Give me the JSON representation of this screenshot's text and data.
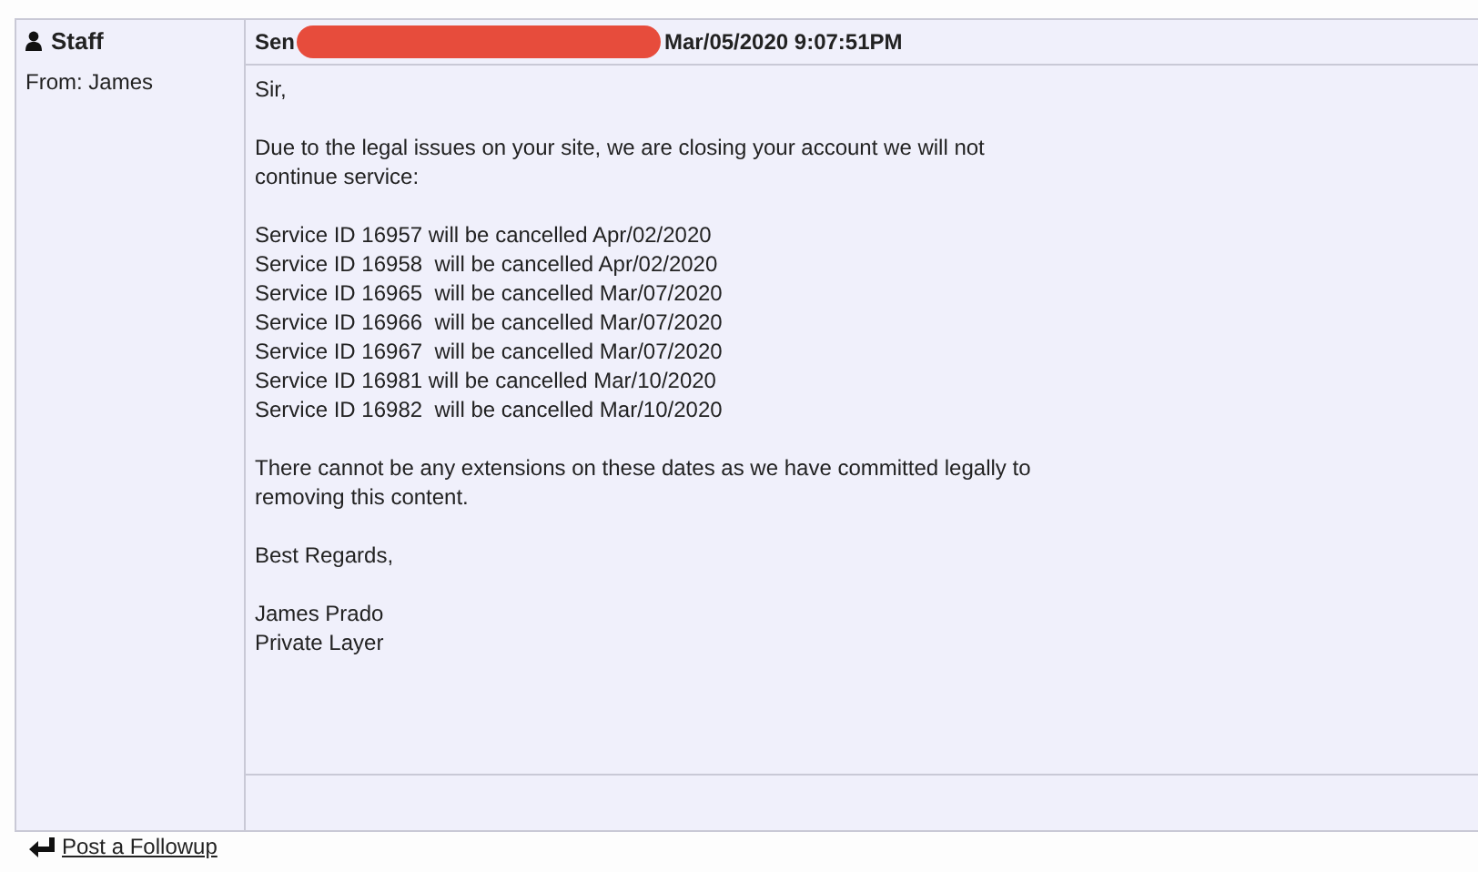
{
  "message": {
    "author": "Staff",
    "from": "From: James",
    "header_prefix": "Sen",
    "header_date": "Mar/05/2020 9:07:51PM",
    "body": [
      [
        "Sir,"
      ],
      [
        "Due to the legal issues on your site, we are closing your account we will not",
        "continue service:"
      ],
      [
        "Service ID 16957 will be cancelled Apr/02/2020",
        "Service ID 16958  will be cancelled Apr/02/2020",
        "Service ID 16965  will be cancelled Mar/07/2020",
        "Service ID 16966  will be cancelled Mar/07/2020",
        "Service ID 16967  will be cancelled Mar/07/2020",
        "Service ID 16981 will be cancelled Mar/10/2020",
        "Service ID 16982  will be cancelled Mar/10/2020"
      ],
      [
        "There cannot be any extensions on these dates as we have committed legally to",
        "removing this content."
      ],
      [
        "Best Regards,"
      ],
      [
        "James Prado",
        "Private Layer"
      ]
    ]
  },
  "bottom_link": {
    "label": "Post a Followup"
  }
}
